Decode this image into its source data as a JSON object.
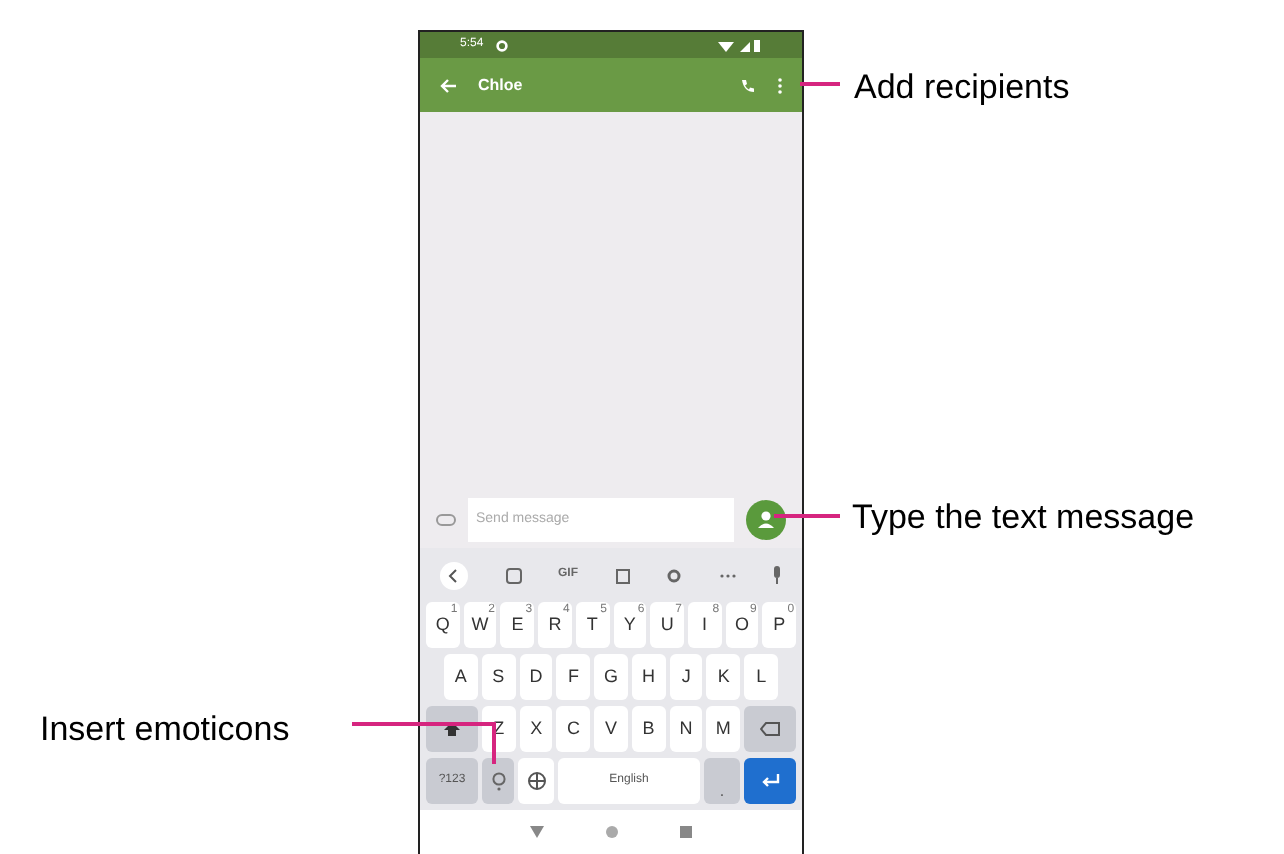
{
  "phone": {
    "status_bar": {
      "time": "5:54"
    },
    "app_bar": {
      "title": "Chloe"
    },
    "compose": {
      "placeholder": "Send message"
    },
    "suggestion_bar": {
      "gif": "GIF"
    },
    "keyboard": {
      "rows": [
        [
          {
            "label": "Q",
            "hint": "1"
          },
          {
            "label": "W",
            "hint": "2"
          },
          {
            "label": "E",
            "hint": "3"
          },
          {
            "label": "R",
            "hint": "4"
          },
          {
            "label": "T",
            "hint": "5"
          },
          {
            "label": "Y",
            "hint": "6"
          },
          {
            "label": "U",
            "hint": "7"
          },
          {
            "label": "I",
            "hint": "8"
          },
          {
            "label": "O",
            "hint": "9"
          },
          {
            "label": "P",
            "hint": "0"
          }
        ],
        [
          {
            "label": "A"
          },
          {
            "label": "S"
          },
          {
            "label": "D"
          },
          {
            "label": "F"
          },
          {
            "label": "G"
          },
          {
            "label": "H"
          },
          {
            "label": "J"
          },
          {
            "label": "K"
          },
          {
            "label": "L"
          }
        ],
        [
          {
            "label": "Z"
          },
          {
            "label": "X"
          },
          {
            "label": "C"
          },
          {
            "label": "V"
          },
          {
            "label": "B"
          },
          {
            "label": "N"
          },
          {
            "label": "M"
          }
        ]
      ],
      "symbols": "?123",
      "space": "English",
      "period": "."
    }
  },
  "callouts": [
    {
      "text": "Add recipients"
    },
    {
      "text": "Type the text message"
    },
    {
      "text": "Insert emoticons"
    }
  ]
}
